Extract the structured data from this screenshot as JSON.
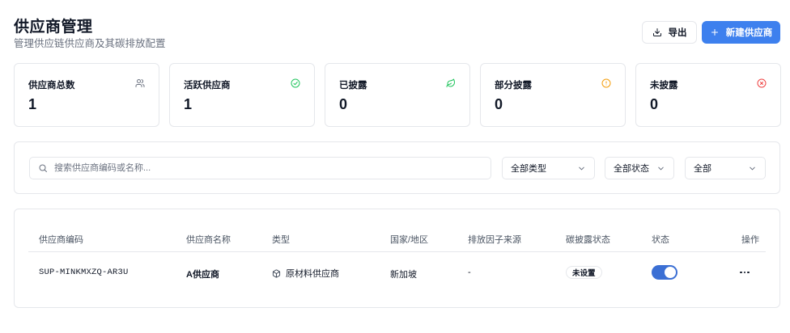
{
  "header": {
    "title": "供应商管理",
    "subtitle": "管理供应链供应商及其碳排放配置"
  },
  "actions": {
    "export_label": "导出",
    "create_label": "新建供应商",
    "accent_color": "#3d80ee"
  },
  "stats": [
    {
      "label": "供应商总数",
      "value": "1",
      "icon": "users-icon",
      "color": "#6b7280"
    },
    {
      "label": "活跃供应商",
      "value": "1",
      "icon": "check-circle-icon",
      "color": "#22c55e"
    },
    {
      "label": "已披露",
      "value": "0",
      "icon": "leaf-icon",
      "color": "#22c55e"
    },
    {
      "label": "部分披露",
      "value": "0",
      "icon": "alert-circle-icon",
      "color": "#f59e0b"
    },
    {
      "label": "未披露",
      "value": "0",
      "icon": "x-circle-icon",
      "color": "#ef4444"
    }
  ],
  "filters": {
    "search_placeholder": "搜索供应商编码或名称...",
    "type_select": "全部类型",
    "status_select": "全部状态",
    "disclosure_select": "全部"
  },
  "table": {
    "columns": [
      "供应商编码",
      "供应商名称",
      "类型",
      "国家/地区",
      "排放因子来源",
      "碳披露状态",
      "状态",
      "操作"
    ],
    "rows": [
      {
        "code": "SUP-MINKMXZQ-AR3U",
        "name": "A供应商",
        "type": "原材料供应商",
        "country": "新加坡",
        "factor_source": "-",
        "disclosure": "未设置",
        "active": true
      }
    ]
  }
}
